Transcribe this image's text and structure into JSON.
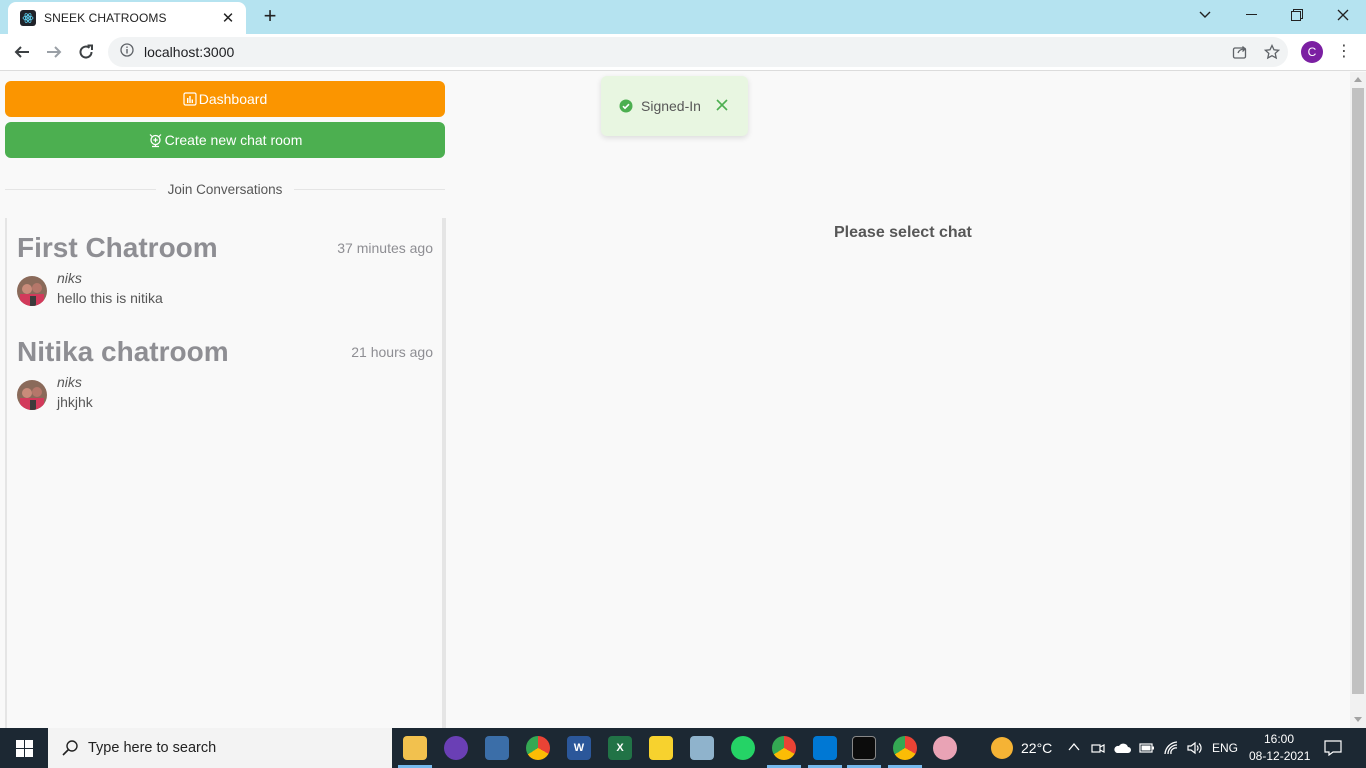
{
  "browser": {
    "tab_title": "SNEEK CHATROOMS",
    "tab_close": "✕",
    "new_tab": "+",
    "url": "localhost:3000",
    "profile_initial": "C"
  },
  "app": {
    "dashboard_label": "Dashboard",
    "create_room_label": "Create new chat room",
    "join_label": "Join Conversations",
    "empty_state": "Please select chat",
    "toast_text": "Signed-In",
    "rooms": [
      {
        "name": "First Chatroom",
        "time": "37 minutes ago",
        "author": "niks",
        "message": "hello this is nitika"
      },
      {
        "name": "Nitika chatroom",
        "time": "21 hours ago",
        "author": "niks",
        "message": "jhkjhk"
      }
    ]
  },
  "taskbar": {
    "search_placeholder": "Type here to search",
    "temperature": "22°C",
    "language": "ENG",
    "time": "16:00",
    "date": "08-12-2021"
  },
  "colors": {
    "dashboard": "#fb9500",
    "create": "#4caf50",
    "toast_bg": "#e8f6e1",
    "tab_strip": "#b5e3f0"
  }
}
